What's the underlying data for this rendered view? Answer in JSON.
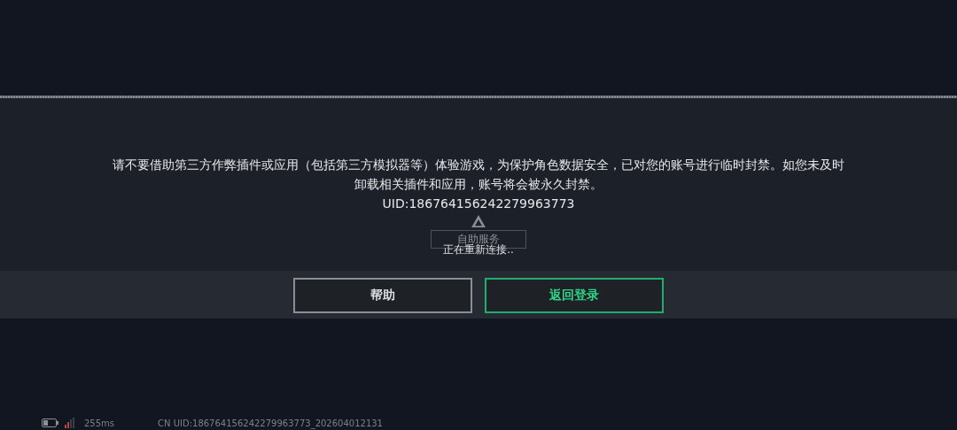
{
  "dialog": {
    "message": "请不要借助第三方作弊插件或应用（包括第三方模拟器等）体验游戏，为保护角色数据安全，已对您的账号进行临时封禁。如您未及时卸载相关插件和应用，账号将会被永久封禁。",
    "uid": "UID:186764156242279963773",
    "buttons": [
      {
        "label": "帮助",
        "kind": "secondary"
      },
      {
        "label": "返回登录",
        "kind": "primary"
      }
    ]
  },
  "reconnect": {
    "service_label": "自助服务",
    "status": "正在重新连接.."
  },
  "status_bar": {
    "ping": "255ms",
    "build": "CN UID:186764156242279963773_202604012131"
  }
}
